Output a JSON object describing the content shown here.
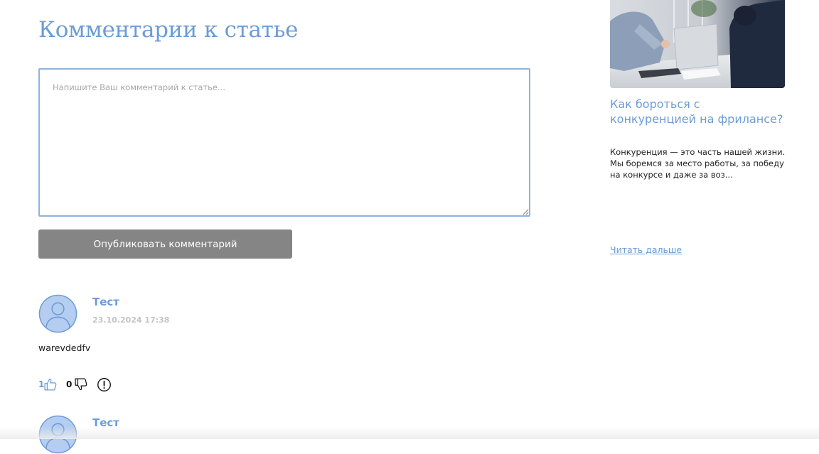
{
  "page": {
    "title": "Комментарии к статье"
  },
  "comment_form": {
    "placeholder": "Напишите Ваш комментарий к статье...",
    "value": "",
    "submit_label": "Опубликовать комментарий"
  },
  "comments": [
    {
      "author": "Тест",
      "date": "23.10.2024 17:38",
      "text": "warevdedfv",
      "likes": "1",
      "dislikes": "0"
    },
    {
      "author": "Тест"
    }
  ],
  "sidebar": {
    "article": {
      "title": "Как бороться с конкуренцией на фрилансе?",
      "excerpt": "Конкуренция — это часть нашей жизни. Мы боремся за место работы, за победу на конкурсе и даже за воз...",
      "read_more": "Читать дальше"
    }
  },
  "icons": {
    "avatar": "user-avatar-icon",
    "like": "thumbs-up-icon",
    "dislike": "thumbs-down-icon",
    "report": "exclamation-circle-icon"
  },
  "colors": {
    "accent": "#6c9bd6",
    "button": "#858585",
    "avatar_fill": "#b4cdf0",
    "date": "#c4c4c4"
  }
}
